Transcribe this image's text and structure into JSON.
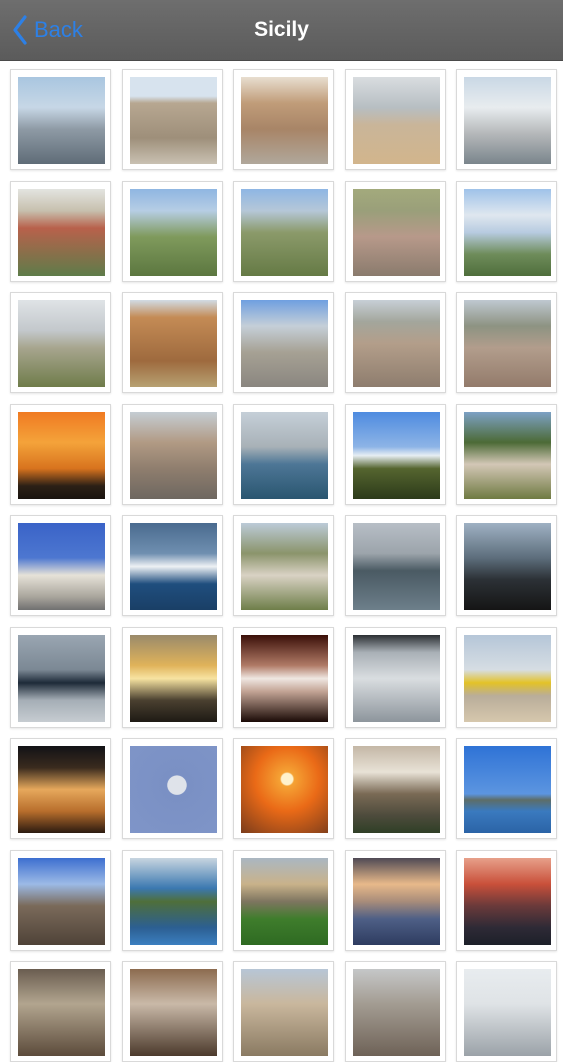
{
  "nav": {
    "back_label": "Back",
    "title": "Sicily"
  },
  "colors": {
    "navbar": "#606060",
    "accent": "#2d80e6",
    "title_text": "#ffffff"
  },
  "gallery": [
    {
      "name": "harbor-boats",
      "bg": "linear-gradient(#a9c6e0 0%,#c7d7e6 35%,#8e9aa5 60%,#5f6c77 100%)"
    },
    {
      "name": "stone-church",
      "bg": "linear-gradient(#d7e3ee 0%,#d7e3ee 22%,#b7a791 30%,#9e8f7a 70%,#c9c1b2 100%)"
    },
    {
      "name": "old-building",
      "bg": "linear-gradient(#e8ded0 0%,#c09c79 30%,#a88567 60%,#b0a79b 100%)"
    },
    {
      "name": "coastal-road",
      "bg": "linear-gradient(#d9dde0 0%,#b7bec2 35%,#c9b599 55%,#d2b58c 100%)"
    },
    {
      "name": "seaside-houses",
      "bg": "linear-gradient(#c9d8e5 0%,#e8ecef 35%,#b5b8ba 65%,#7a858c 100%)"
    },
    {
      "name": "village-bell-tower",
      "bg": "linear-gradient(#e3e4e0 0%,#c7c0ae 25%,#b8614b 45%,#5e7c4a 100%)"
    },
    {
      "name": "hilltop-village",
      "bg": "linear-gradient(#8fb6e2 0%,#b6cde4 25%,#7f9a5c 55%,#5c7740 100%)"
    },
    {
      "name": "valley-town",
      "bg": "linear-gradient(#8eb6e4 0%,#b5c7d8 25%,#8b9a6a 50%,#657a45 100%)"
    },
    {
      "name": "town-rooftops",
      "bg": "linear-gradient(#a3aa7c 0%,#9a9f7a 25%,#b7998a 55%,#8a7b6d 100%)"
    },
    {
      "name": "sea-clouds",
      "bg": "linear-gradient(#9fc2e9 0%,#dfe7ef 30%,#b7cbe0 50%,#6e8c5a 75%,#4f6e3c 100%)"
    },
    {
      "name": "hills-landscape",
      "bg": "linear-gradient(#dfe3e6 0%,#c3c8cc 35%,#a7a58e 55%,#6f7c4a 100%)"
    },
    {
      "name": "brick-church",
      "bg": "linear-gradient(#d1dbe4 0%,#c48b55 20%,#9e6a3e 70%,#b7a172 100%)"
    },
    {
      "name": "baroque-church",
      "bg": "linear-gradient(#6f9fe0 0%,#c5cfd8 30%,#a6a194 60%,#8a8680 100%)"
    },
    {
      "name": "dense-town",
      "bg": "linear-gradient(#c7cfd6 0%,#a3a69c 25%,#b39e8a 50%,#8e7d6e 100%)"
    },
    {
      "name": "town-panorama",
      "bg": "linear-gradient(#bfc8d0 0%,#8d9382 30%,#b29d8c 55%,#937b6b 100%)"
    },
    {
      "name": "orange-sunset",
      "bg": "linear-gradient(#f07a22 0%,#f4a33a 35%,#d8731e 65%,#2c2016 85%,#1a140f 100%)"
    },
    {
      "name": "narrow-street",
      "bg": "linear-gradient(#c5cdd3 0%,#b19a84 35%,#8f7e6e 65%,#6e6760 100%)"
    },
    {
      "name": "fishing-boats",
      "bg": "linear-gradient(#c5cfd8 0%,#a8b1b7 40%,#4d7696 60%,#2a5670 100%)"
    },
    {
      "name": "snowy-volcano",
      "bg": "linear-gradient(#4e8be0 0%,#8db4e6 40%,#e7eef3 50%,#55652f 65%,#2c3a1a 100%)"
    },
    {
      "name": "garden-statue",
      "bg": "linear-gradient(#7da1c5 0%,#4c6a36 35%,#d3c7b6 60%,#6f7a42 100%)"
    },
    {
      "name": "palm-church",
      "bg": "linear-gradient(#3a63c8 0%,#4d77d0 40%,#e6e2d8 60%,#a9a59c 85%,#707070 100%)"
    },
    {
      "name": "ferry-ship",
      "bg": "linear-gradient(#4a6b8f 0%,#6f8fb0 35%,#eef1f4 50%,#1f4e7e 70%,#1a3f66 100%)"
    },
    {
      "name": "green-hills-town",
      "bg": "linear-gradient(#bccbd8 0%,#8b946b 35%,#d9d2c4 60%,#6e7e49 100%)"
    },
    {
      "name": "navy-ship",
      "bg": "linear-gradient(#b7bec6 0%,#9ca4ab 35%,#4a5a63 55%,#6d7f8a 100%)"
    },
    {
      "name": "ferry-deck-cars",
      "bg": "linear-gradient(#9fb1c3 0%,#5d6e7c 40%,#2c3136 65%,#151515 100%)"
    },
    {
      "name": "speedboat",
      "bg": "linear-gradient(#9aa6b2 0%,#7b8894 40%,#1d2a38 55%,#a5aeb6 75%,#c6ccd1 100%)"
    },
    {
      "name": "pier-sunset",
      "bg": "linear-gradient(#9a8a6b 0%,#e0b35a 35%,#f7e3a1 50%,#4a4030 75%,#1e1a14 100%)"
    },
    {
      "name": "fountain-night",
      "bg": "linear-gradient(#3a0f08 0%,#b07a66 35%,#efe7e2 50%,#c2a394 65%,#1a0a06 100%)"
    },
    {
      "name": "sparkling-sea",
      "bg": "linear-gradient(#2b2f33 0%,#a9b0b6 20%,#d9dde0 50%,#8d959c 100%)"
    },
    {
      "name": "yellow-plane",
      "bg": "linear-gradient(#b5c6d8 0%,#d6dde3 40%,#e3c227 55%,#b9ad9a 70%,#d6c7ad 100%)"
    },
    {
      "name": "lit-church-night",
      "bg": "linear-gradient(#121216 0%,#3a2b1e 25%,#e6a85c 50%,#b86e2c 75%,#2b1a10 100%)"
    },
    {
      "name": "moon-sky",
      "bg": "radial-gradient(circle at 54% 45%, #dfe3ea 0 14%, #7a90c4 15%, #7f95c8 100%)"
    },
    {
      "name": "sun-over-sea",
      "bg": "radial-gradient(circle at 53% 38%, #fff2cc 0 8%, #f5a234 10%, #ea6a17 45%, #7a3c1b 100%)"
    },
    {
      "name": "stone-stairs",
      "bg": "linear-gradient(#c4b7a6 0%,#e8e2d6 30%,#7a6a55 55%,#4d4b3c 80%,#2f3f26 100%)"
    },
    {
      "name": "blue-sea-island",
      "bg": "linear-gradient(#2f73d6 0%,#5c95e0 55%,#5d6d68 62%,#3a7abf 75%,#2b63a6 100%)"
    },
    {
      "name": "volcano-slope",
      "bg": "linear-gradient(#3d6fd0 0%,#9cbae6 30%,#7a6a5a 55%,#4f4338 100%)"
    },
    {
      "name": "isola-bella",
      "bg": "linear-gradient(#c8d5e0 0%,#3b78b0 35%,#4f6f3a 50%,#2c5f92 80%,#3b7fc0 100%)"
    },
    {
      "name": "rural-farmhouse",
      "bg": "linear-gradient(#aab7c2 0%,#c9b28a 30%,#7e7560 50%,#3f7d2c 70%,#2e6a22 100%)"
    },
    {
      "name": "cloudy-sunset-sea",
      "bg": "linear-gradient(#4f4a55 0%,#e8b98a 30%,#a88c7a 50%,#4e5f86 70%,#2e3c60 100%)"
    },
    {
      "name": "red-sunset-sea",
      "bg": "linear-gradient(#e7a08a 0%,#c9503a 30%,#6a3a3a 55%,#2e2a36 80%,#1d2029 100%)"
    },
    {
      "name": "dusk-landscape",
      "bg": "linear-gradient(#6a5d50 0%,#b2a58f 40%,#5c4b3b 100%)"
    },
    {
      "name": "cave-arches",
      "bg": "linear-gradient(#8c6b4f 0%,#c9b9a8 40%,#4c3a2c 100%)"
    },
    {
      "name": "stone-alley",
      "bg": "linear-gradient(#b7c6d6 0%,#c9b79d 40%,#8a7a62 100%)"
    },
    {
      "name": "monument-ruins",
      "bg": "linear-gradient(#c5c7c8 0%,#a39c92 40%,#6e6257 100%)"
    },
    {
      "name": "dome-building",
      "bg": "linear-gradient(#e8ecef 0%,#dfe3e6 40%,#9ba2a8 100%)"
    }
  ]
}
